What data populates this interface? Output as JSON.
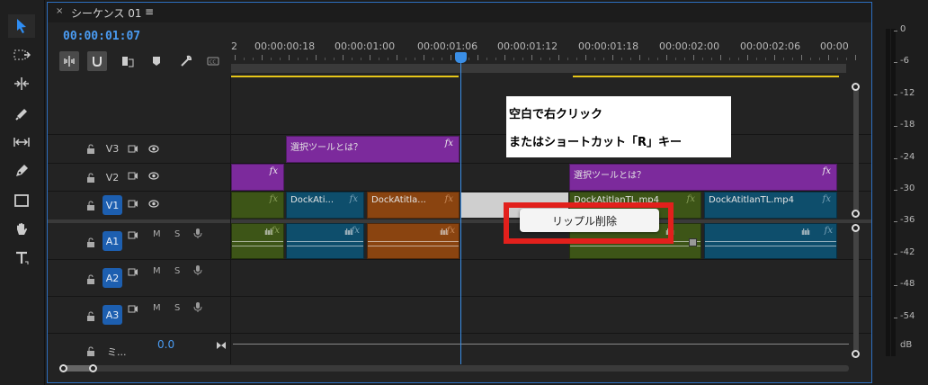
{
  "tab": {
    "close": "×",
    "title": "シーケンス 01",
    "menu": "≡"
  },
  "timecode": "00:00:01:07",
  "ruler_labels": [
    "2",
    "00:00:00:18",
    "00:00:01:00",
    "00:00:01:06",
    "00:00:01:12",
    "00:00:01:18",
    "00:00:02:00",
    "00:00:02:06",
    "00:00"
  ],
  "tracks": {
    "v3": {
      "label": "V3"
    },
    "v2": {
      "label": "V2"
    },
    "v1": {
      "label": "V1"
    },
    "a1": {
      "label": "A1",
      "m": "M",
      "s": "S"
    },
    "a2": {
      "label": "A2",
      "m": "M",
      "s": "S"
    },
    "a3": {
      "label": "A3",
      "m": "M",
      "s": "S"
    },
    "master": {
      "label": "ミ...",
      "value": "0.0"
    }
  },
  "clips": {
    "v3_title": "選択ツールとは？",
    "v2_title": "選択ツールとは？",
    "v1_a": "DockAti...",
    "v1_b": "DockAtitla...",
    "v1_c": "DockAtitlanTL.mp4",
    "v1_d": "DockAtitlanTL.mp4",
    "fx": "fx",
    "wave": "ılıılı"
  },
  "annotation": {
    "line1": "空白で右クリック",
    "line2": "またはショートカット「R」キー"
  },
  "context_menu": {
    "item": "リップル削除"
  },
  "meter": {
    "labels": [
      "0",
      "-6",
      "-12",
      "-18",
      "-24",
      "-30",
      "-36",
      "-42",
      "-48",
      "-54",
      "dB"
    ]
  },
  "colors": {
    "accent": "#2d6fc0",
    "timecode": "#4a9bf2",
    "purple_clip": "#7c2a9c",
    "green_clip": "#3d5517",
    "teal_clip": "#0e4e6c",
    "orange_clip": "#8a4410",
    "work_area": "#e6c619",
    "highlight_box": "#e2201c"
  },
  "icons": [
    "selection-tool-icon",
    "track-select-icon",
    "ripple-edit-icon",
    "razor-icon",
    "slip-icon",
    "pen-icon",
    "rectangle-icon",
    "hand-icon",
    "type-icon"
  ]
}
